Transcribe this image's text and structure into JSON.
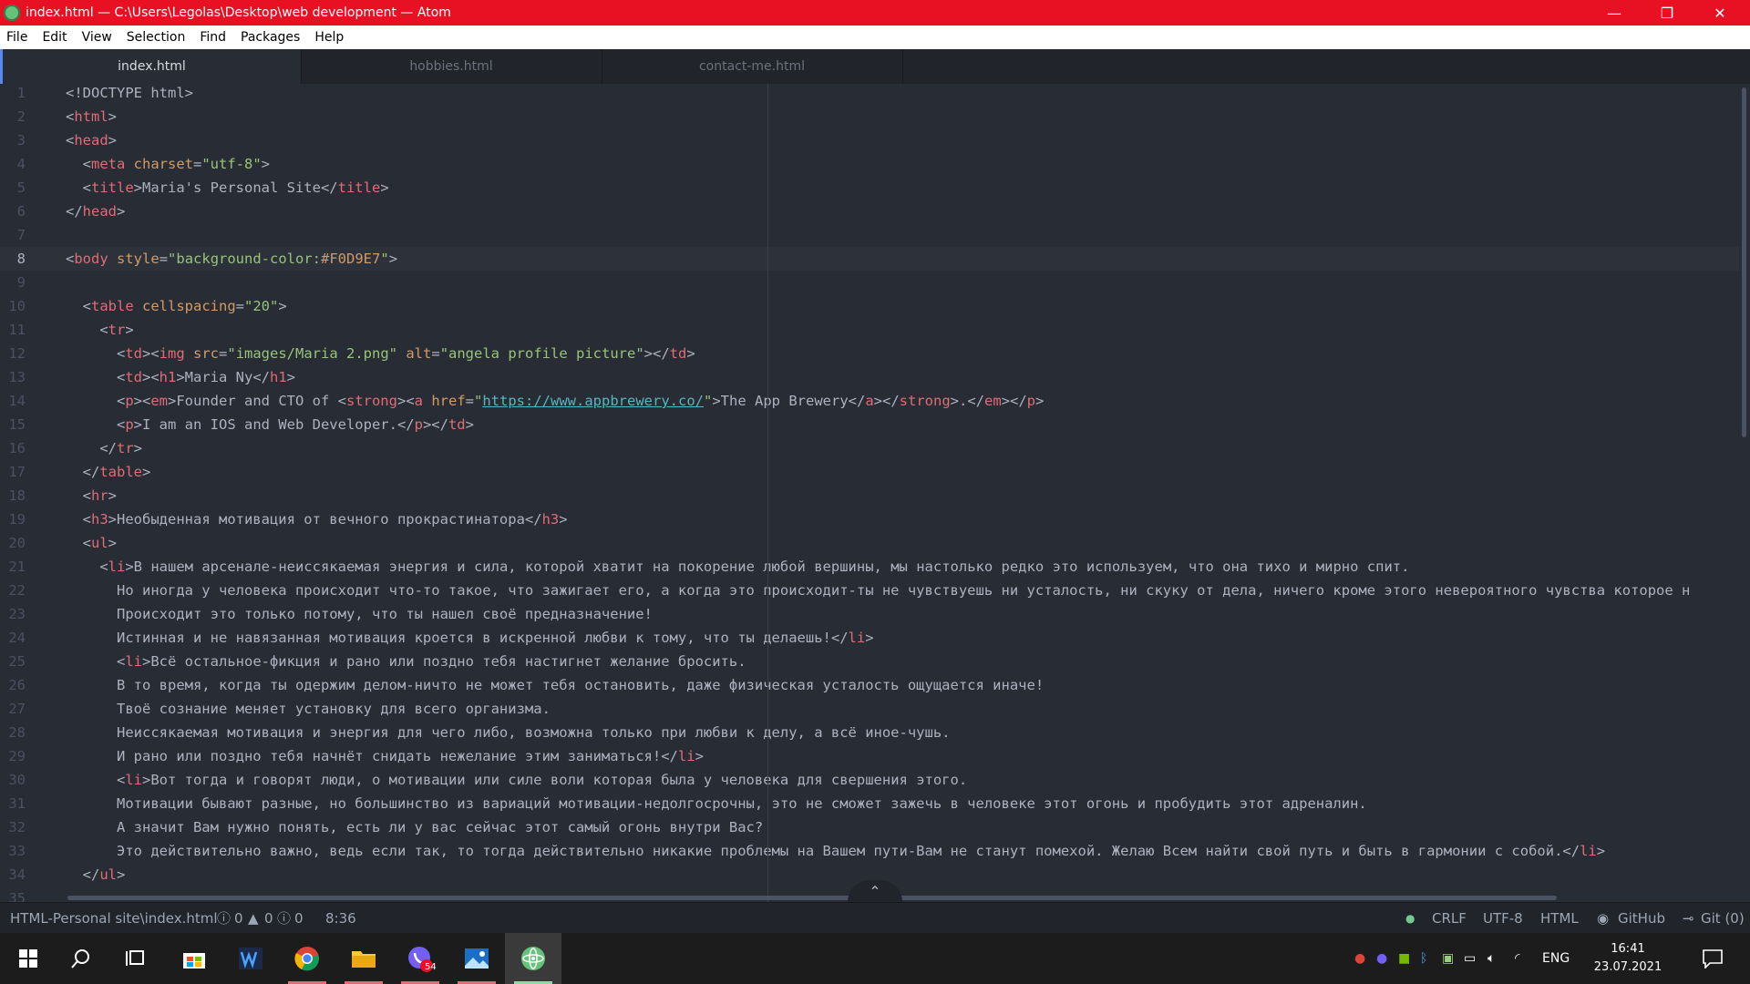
{
  "window": {
    "title": "index.html — C:\\Users\\Legolas\\Desktop\\web development — Atom",
    "minimize": "—",
    "maximize": "❐",
    "close": "✕"
  },
  "menu": [
    "File",
    "Edit",
    "View",
    "Selection",
    "Find",
    "Packages",
    "Help"
  ],
  "tabs": [
    {
      "label": "index.html",
      "active": true
    },
    {
      "label": "hobbies.html",
      "active": false
    },
    {
      "label": "contact-me.html",
      "active": false
    }
  ],
  "editor": {
    "cursor_line": 8,
    "lines": [
      [
        [
          "p",
          "<!DOCTYPE html>"
        ]
      ],
      [
        [
          "p",
          "<"
        ],
        [
          "t",
          "html"
        ],
        [
          "p",
          ">"
        ]
      ],
      [
        [
          "p",
          "<"
        ],
        [
          "t",
          "head"
        ],
        [
          "p",
          ">"
        ]
      ],
      [
        [
          "p",
          "  <"
        ],
        [
          "t",
          "meta"
        ],
        [
          "p",
          " "
        ],
        [
          "a",
          "charset"
        ],
        [
          "p",
          "="
        ],
        [
          "s",
          "\"utf-8\""
        ],
        [
          "p",
          ">"
        ]
      ],
      [
        [
          "p",
          "  <"
        ],
        [
          "t",
          "title"
        ],
        [
          "p",
          ">Maria's Personal Site</"
        ],
        [
          "t",
          "title"
        ],
        [
          "p",
          ">"
        ]
      ],
      [
        [
          "p",
          "</"
        ],
        [
          "t",
          "head"
        ],
        [
          "p",
          ">"
        ]
      ],
      [
        [
          "p",
          ""
        ]
      ],
      [
        [
          "p",
          "<"
        ],
        [
          "t",
          "body"
        ],
        [
          "p",
          " "
        ],
        [
          "a",
          "style"
        ],
        [
          "p",
          "="
        ],
        [
          "s",
          "\"background-color:"
        ],
        [
          "a",
          "#F0D9E7"
        ],
        [
          "s",
          "\""
        ],
        [
          "p",
          ">"
        ]
      ],
      [
        [
          "p",
          ""
        ]
      ],
      [
        [
          "p",
          "  <"
        ],
        [
          "t",
          "table"
        ],
        [
          "p",
          " "
        ],
        [
          "a",
          "cellspacing"
        ],
        [
          "p",
          "="
        ],
        [
          "s",
          "\"20\""
        ],
        [
          "p",
          ">"
        ]
      ],
      [
        [
          "p",
          "    <"
        ],
        [
          "t",
          "tr"
        ],
        [
          "p",
          ">"
        ]
      ],
      [
        [
          "p",
          "      <"
        ],
        [
          "t",
          "td"
        ],
        [
          "p",
          "><"
        ],
        [
          "t",
          "img"
        ],
        [
          "p",
          " "
        ],
        [
          "a",
          "src"
        ],
        [
          "p",
          "="
        ],
        [
          "s",
          "\"images/Maria 2.png\""
        ],
        [
          "p",
          " "
        ],
        [
          "a",
          "alt"
        ],
        [
          "p",
          "="
        ],
        [
          "s",
          "\"angela profile picture\""
        ],
        [
          "p",
          "></"
        ],
        [
          "t",
          "td"
        ],
        [
          "p",
          ">"
        ]
      ],
      [
        [
          "p",
          "      <"
        ],
        [
          "t",
          "td"
        ],
        [
          "p",
          "><"
        ],
        [
          "t",
          "h1"
        ],
        [
          "p",
          ">Maria Ny</"
        ],
        [
          "t",
          "h1"
        ],
        [
          "p",
          ">"
        ]
      ],
      [
        [
          "p",
          "      <"
        ],
        [
          "t",
          "p"
        ],
        [
          "p",
          "><"
        ],
        [
          "t",
          "em"
        ],
        [
          "p",
          ">Founder and CTO of <"
        ],
        [
          "t",
          "strong"
        ],
        [
          "p",
          "><"
        ],
        [
          "t",
          "a"
        ],
        [
          "p",
          " "
        ],
        [
          "a",
          "href"
        ],
        [
          "p",
          "="
        ],
        [
          "s",
          "\""
        ],
        [
          "u",
          "https://www.appbrewery.co/"
        ],
        [
          "s",
          "\""
        ],
        [
          "p",
          ">The App Brewery</"
        ],
        [
          "t",
          "a"
        ],
        [
          "p",
          "></"
        ],
        [
          "t",
          "strong"
        ],
        [
          "p",
          ">.</"
        ],
        [
          "t",
          "em"
        ],
        [
          "p",
          "></"
        ],
        [
          "t",
          "p"
        ],
        [
          "p",
          ">"
        ]
      ],
      [
        [
          "p",
          "      <"
        ],
        [
          "t",
          "p"
        ],
        [
          "p",
          ">I am an IOS and Web Developer.</"
        ],
        [
          "t",
          "p"
        ],
        [
          "p",
          "></"
        ],
        [
          "t",
          "td"
        ],
        [
          "p",
          ">"
        ]
      ],
      [
        [
          "p",
          "    </"
        ],
        [
          "t",
          "tr"
        ],
        [
          "p",
          ">"
        ]
      ],
      [
        [
          "p",
          "  </"
        ],
        [
          "t",
          "table"
        ],
        [
          "p",
          ">"
        ]
      ],
      [
        [
          "p",
          "  <"
        ],
        [
          "t",
          "hr"
        ],
        [
          "p",
          ">"
        ]
      ],
      [
        [
          "p",
          "  <"
        ],
        [
          "t",
          "h3"
        ],
        [
          "p",
          ">Необыденная мотивация от вечного прокрастинатора</"
        ],
        [
          "t",
          "h3"
        ],
        [
          "p",
          ">"
        ]
      ],
      [
        [
          "p",
          "  <"
        ],
        [
          "t",
          "ul"
        ],
        [
          "p",
          ">"
        ]
      ],
      [
        [
          "p",
          "    <"
        ],
        [
          "t",
          "li"
        ],
        [
          "p",
          ">В нашем арсенале-неиссякаемая энергия и сила, которой хватит на покорение любой вершины, мы настолько редко это используем, что она тихо и мирно спит."
        ]
      ],
      [
        [
          "p",
          "      Но иногда у человека происходит что-то такое, что зажигает его, а когда это происходит-ты не чувствуешь ни усталость, ни скуку от дела, ничего кроме этого невероятного чувства которое н"
        ]
      ],
      [
        [
          "p",
          "      Происходит это только потому, что ты нашел своё предназначение!"
        ]
      ],
      [
        [
          "p",
          "      Истинная и не навязанная мотивация кроется в искренной любви к тому, что ты делаешь!</"
        ],
        [
          "t",
          "li"
        ],
        [
          "p",
          ">"
        ]
      ],
      [
        [
          "p",
          "      <"
        ],
        [
          "t",
          "li"
        ],
        [
          "p",
          ">Всё остальное-фикция и рано или поздно тебя настигнет желание бросить."
        ]
      ],
      [
        [
          "p",
          "      В то время, когда ты одержим делом-ничто не может тебя остановить, даже физическая усталость ощущается иначе!"
        ]
      ],
      [
        [
          "p",
          "      Твоё сознание меняет установку для всего организма."
        ]
      ],
      [
        [
          "p",
          "      Неиссякаемая мотивация и энергия для чего либо, возможна только при любви к делу, а всё иное-чушь."
        ]
      ],
      [
        [
          "p",
          "      И рано или поздно тебя начнёт снидать нежелание этим заниматься!</"
        ],
        [
          "t",
          "li"
        ],
        [
          "p",
          ">"
        ]
      ],
      [
        [
          "p",
          "      <"
        ],
        [
          "t",
          "li"
        ],
        [
          "p",
          ">Вот тогда и говорят люди, о мотивации или силе воли которая была у человека для свершения этого."
        ]
      ],
      [
        [
          "p",
          "      Мотивации бывают разные, но большинство из вариаций мотивации-недолгосрочны, это не сможет зажечь в человеке этот огонь и пробудить этот адреналин."
        ]
      ],
      [
        [
          "p",
          "      А значит Вам нужно понять, есть ли у вас сейчас этот самый огонь внутри Вас?"
        ]
      ],
      [
        [
          "p",
          "      Это действительно важно, ведь если так, то тогда действительно никакие проблемы на Вашем пути-Вам не станут помехой. Желаю Всем найти свой путь и быть в гармонии с собой.</"
        ],
        [
          "t",
          "li"
        ],
        [
          "p",
          ">"
        ]
      ],
      [
        [
          "p",
          "  </"
        ],
        [
          "t",
          "ul"
        ],
        [
          "p",
          ">"
        ]
      ],
      [
        [
          "p",
          ""
        ]
      ]
    ]
  },
  "status": {
    "file_path": "HTML-Personal site\\index.html",
    "errors": "0",
    "warnings": "0",
    "infos": "0",
    "cursor": "8:36",
    "line_ending": "CRLF",
    "encoding": "UTF-8",
    "grammar": "HTML",
    "github": "GitHub",
    "git": "Git (0)"
  },
  "taskbar": {
    "viber_badge": "54",
    "language": "ENG",
    "time": "16:41",
    "date": "23.07.2021"
  },
  "icons": [
    "atom-app-icon",
    "windows-start-icon",
    "search-icon",
    "task-view-icon",
    "store-icon",
    "winamp-icon",
    "chrome-icon",
    "folder-icon",
    "viber-icon",
    "photos-icon",
    "atom-icon",
    "github-icon",
    "git-icon",
    "notification-icon"
  ],
  "colors": {
    "titlebar": "#e81123",
    "editor_bg": "#282c34",
    "tag": "#e06c75",
    "attr": "#d19a66",
    "string": "#98c379"
  }
}
